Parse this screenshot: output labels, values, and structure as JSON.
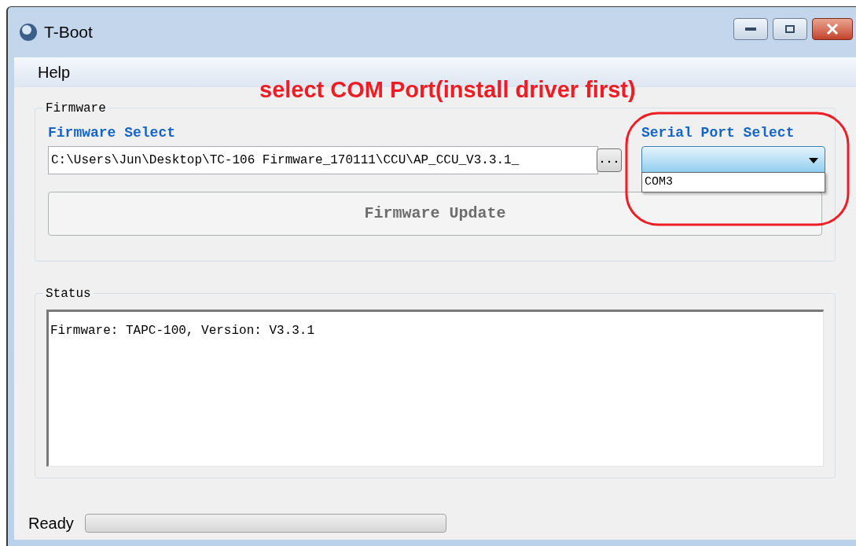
{
  "window": {
    "title": "T-Boot"
  },
  "menu": [
    "Help"
  ],
  "annotation": {
    "text": "select COM Port(install driver first)"
  },
  "firmware_group": {
    "title": "Firmware",
    "firmware_select": {
      "label": "Firmware Select",
      "value": "C:\\Users\\Jun\\Desktop\\TC-106 Firmware_170111\\CCU\\AP_CCU_V3.3.1_",
      "browse": "..."
    },
    "serial_port": {
      "label": "Serial Port Select",
      "expanded": true,
      "options": [
        {
          "label": "COM3",
          "selected": false
        }
      ]
    },
    "update_button": {
      "label": "Firmware Update",
      "disabled": true
    }
  },
  "status_group": {
    "title": "Status",
    "lines": [
      "Firmware: TAPC-100, Version: V3.3.1"
    ]
  },
  "status_bar": {
    "text": "Ready",
    "progress": {
      "level": 0
    }
  }
}
